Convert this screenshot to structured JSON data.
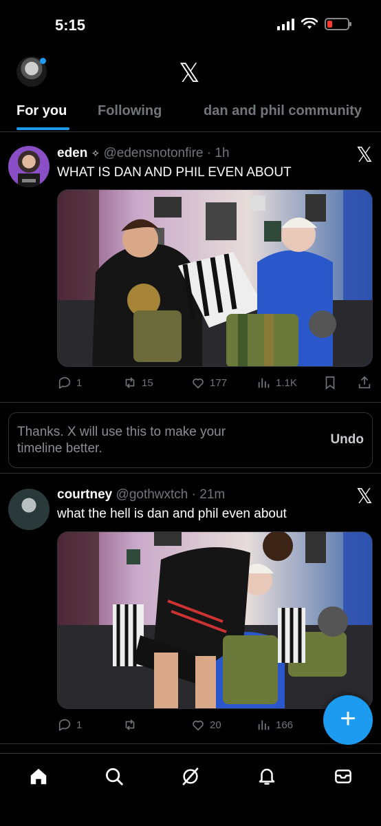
{
  "status_bar": {
    "time": "5:15",
    "battery_level": 0.25
  },
  "header": {
    "logo": "𝕏"
  },
  "tabs": [
    {
      "label": "For you",
      "active": true
    },
    {
      "label": "Following",
      "active": false
    },
    {
      "label": "dan and phil community",
      "active": false
    }
  ],
  "posts": [
    {
      "name": "eden",
      "badge": "✧",
      "handle": "@edensnotonfire",
      "time": "1h",
      "text": "WHAT IS DAN AND PHIL EVEN ABOUT",
      "actions": {
        "replies": "1",
        "reposts": "15",
        "likes": "177",
        "views": "1.1K"
      }
    },
    {
      "name": "courtney",
      "badge": "",
      "handle": "@gothwxtch",
      "time": "21m",
      "text": "what the hell is dan and phil even about",
      "actions": {
        "replies": "1",
        "reposts": "",
        "likes": "20",
        "views": "166"
      }
    }
  ],
  "feedback": {
    "text": "Thanks. X will use this to make your timeline better.",
    "undo_label": "Undo"
  },
  "close_glyph": "𝕏",
  "fab_label": "+",
  "colors": {
    "accent": "#1d9bf0",
    "muted": "#71767b",
    "divider": "#2f3336"
  }
}
